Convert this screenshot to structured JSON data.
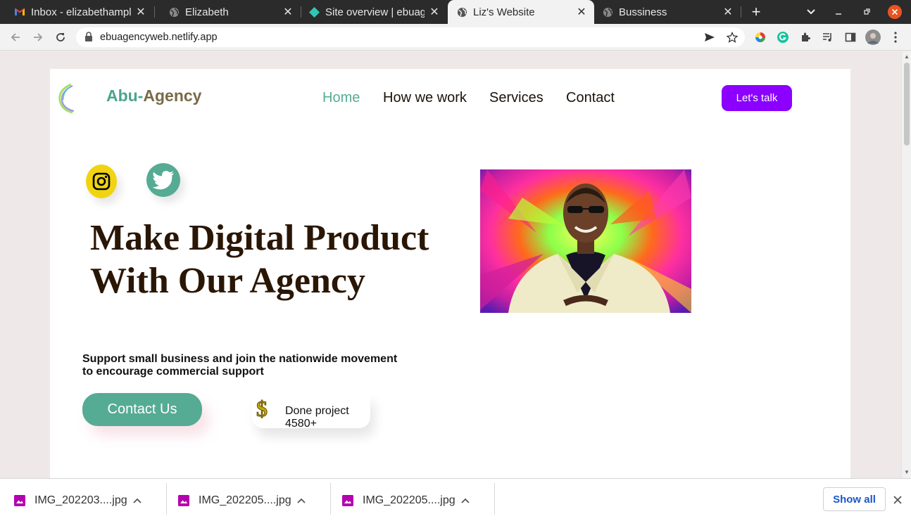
{
  "browser": {
    "tabs": [
      {
        "title": "Inbox - elizabethampl",
        "icon": "gmail-icon"
      },
      {
        "title": "Elizabeth",
        "icon": "globe-icon"
      },
      {
        "title": "Site overview | ebuag",
        "icon": "netlify-icon"
      },
      {
        "title": "Liz's Website",
        "icon": "globe-icon",
        "active": true
      },
      {
        "title": "Bussiness",
        "icon": "globe-icon"
      }
    ],
    "url": "ebuagencyweb.netlify.app"
  },
  "site": {
    "brand_part1": "Abu-",
    "brand_part2": "Agency",
    "nav": [
      "Home",
      "How we work",
      "Services",
      "Contact"
    ],
    "cta": "Let's talk",
    "headline_line1": "Make Digital Product",
    "headline_line2": "With Our Agency",
    "subtext_line1": "Support small business and join the nationwide movement",
    "subtext_line2": "to encourage commercial support",
    "contact_button": "Contact Us",
    "stat_label": "Done project",
    "stat_value": "4580+",
    "colors": {
      "accent_green": "#55ab93",
      "purple": "#8b00ff",
      "headline": "#2a1604",
      "instagram_yellow": "#f0d411"
    }
  },
  "downloads": {
    "files": [
      "IMG_202203....jpg",
      "IMG_202205....jpg",
      "IMG_202205....jpg"
    ],
    "show_all": "Show all"
  }
}
